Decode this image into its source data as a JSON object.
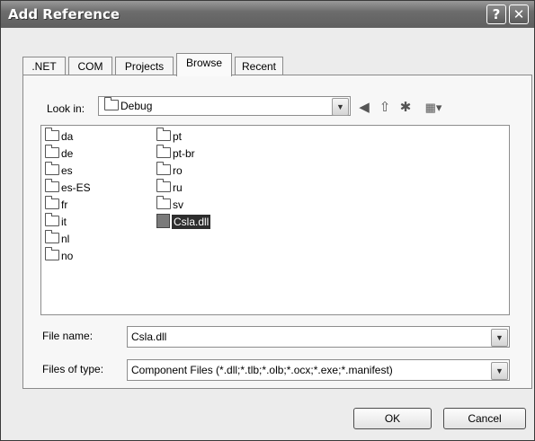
{
  "window": {
    "title": "Add Reference",
    "help_glyph": "?",
    "close_glyph": "✕"
  },
  "tabs": [
    ".NET",
    "COM",
    "Projects",
    "Browse",
    "Recent"
  ],
  "look_in": {
    "label": "Look in:",
    "value": "Debug"
  },
  "toolbar": {
    "back_glyph": "◀",
    "up_glyph": "⇧",
    "new_folder_glyph": "✱",
    "views_glyph": "▦▾"
  },
  "files": {
    "col1": [
      "da",
      "de",
      "es",
      "es-ES",
      "fr",
      "it",
      "nl",
      "no"
    ],
    "col2": [
      "pt",
      "pt-br",
      "ro",
      "ru",
      "sv"
    ],
    "selected": "Csla.dll"
  },
  "file_name": {
    "label": "File name:",
    "value": "Csla.dll"
  },
  "files_of_type": {
    "label": "Files of type:",
    "value": "Component Files (*.dll;*.tlb;*.olb;*.ocx;*.exe;*.manifest)"
  },
  "buttons": {
    "ok": "OK",
    "cancel": "Cancel"
  }
}
